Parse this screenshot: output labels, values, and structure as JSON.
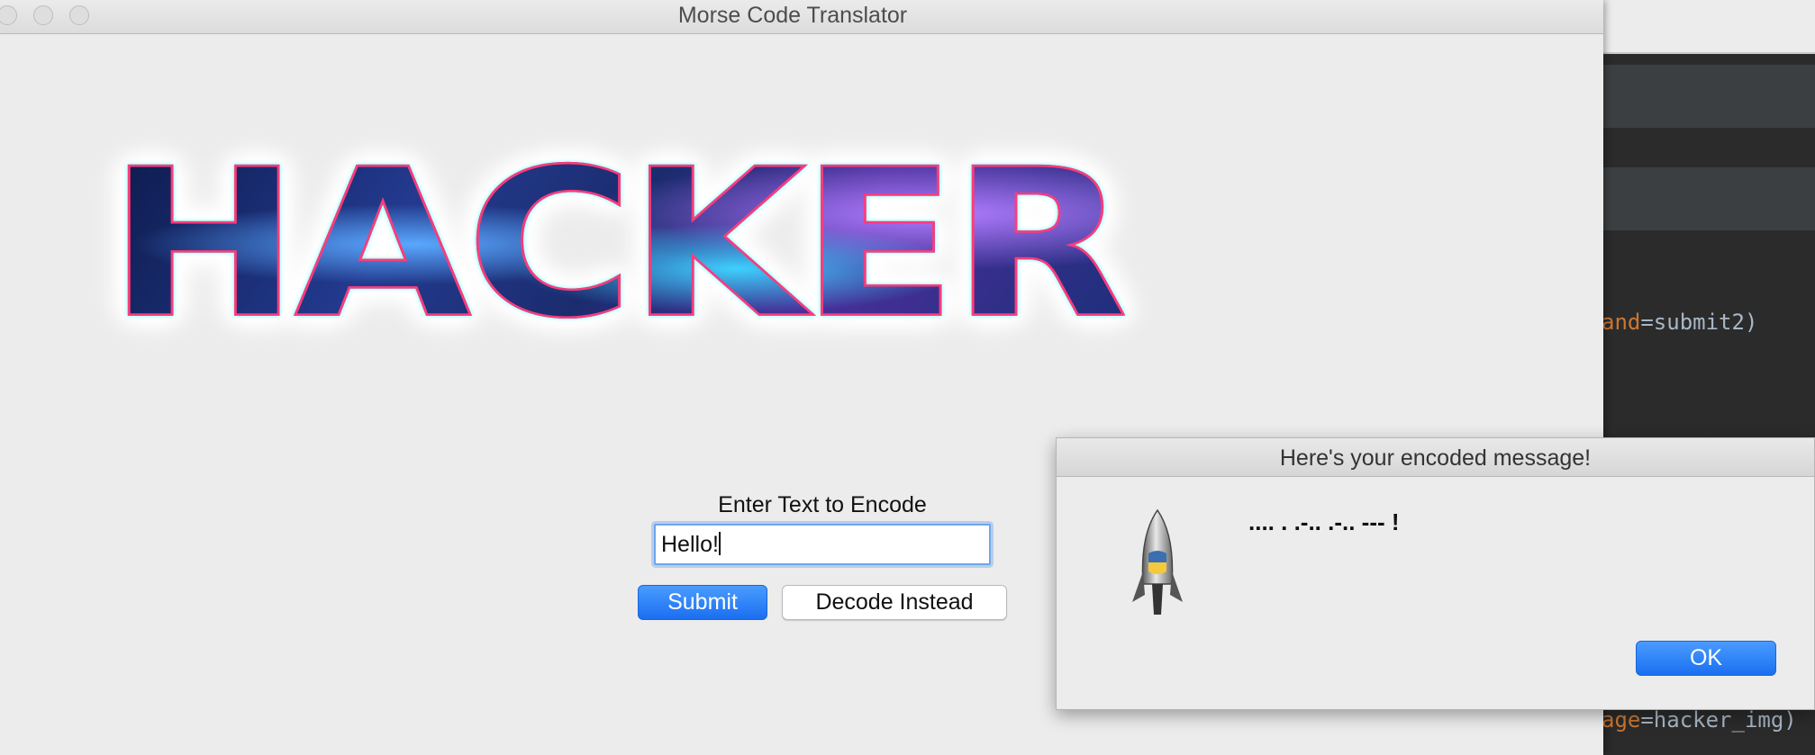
{
  "window": {
    "title": "Morse Code Translator"
  },
  "banner": {
    "text": "HACKER"
  },
  "form": {
    "label": "Enter Text to Encode",
    "input_value": "Hello!",
    "submit_label": "Submit",
    "decode_label": "Decode Instead"
  },
  "dialog": {
    "title": "Here's your encoded message!",
    "message": ".... . .-.. .-.. --- !",
    "ok_label": "OK",
    "icon": "python-launcher-rocket-icon"
  },
  "background_editor": {
    "lines": [
      {
        "keyword": "and",
        "text": "=submit2)"
      },
      {
        "keyword": "age",
        "text": "=hacker_img)"
      }
    ]
  },
  "colors": {
    "accent_blue": "#1b6ff0",
    "window_bg": "#ececec",
    "editor_bg": "#2b2b2b",
    "editor_keyword": "#cc7832"
  }
}
